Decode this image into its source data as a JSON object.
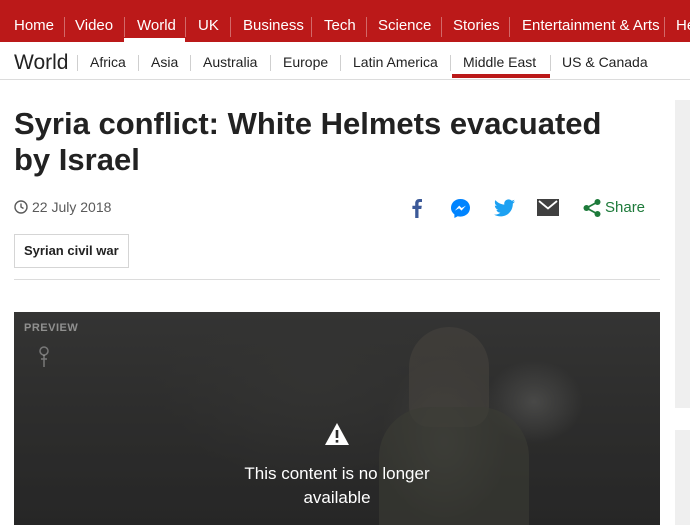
{
  "topnav": {
    "items": [
      "Home",
      "Video",
      "World",
      "UK",
      "Business",
      "Tech",
      "Science",
      "Stories",
      "Entertainment & Arts",
      "He"
    ],
    "active": "World"
  },
  "subnav": {
    "section_title": "World",
    "items": [
      "Africa",
      "Asia",
      "Australia",
      "Europe",
      "Latin America",
      "Middle East",
      "US & Canada"
    ],
    "active": "Middle East"
  },
  "article": {
    "headline_line1": "Syria conflict: White Helmets evacuated",
    "headline_line2": "by Israel",
    "date": "22 July 2018",
    "tag": "Syrian civil war"
  },
  "share": {
    "label": "Share",
    "icons": [
      "facebook-icon",
      "messenger-icon",
      "twitter-icon",
      "email-icon",
      "share-icon"
    ],
    "colors": {
      "facebook": "#3b5998",
      "messenger": "#0084ff",
      "twitter": "#1da1f2",
      "email": "#404040",
      "share": "#1d7a3a"
    }
  },
  "video": {
    "preview_label": "PREVIEW",
    "message_line1": "This content is no longer",
    "message_line2": "available"
  },
  "colors": {
    "brand_red": "#bb1919"
  }
}
